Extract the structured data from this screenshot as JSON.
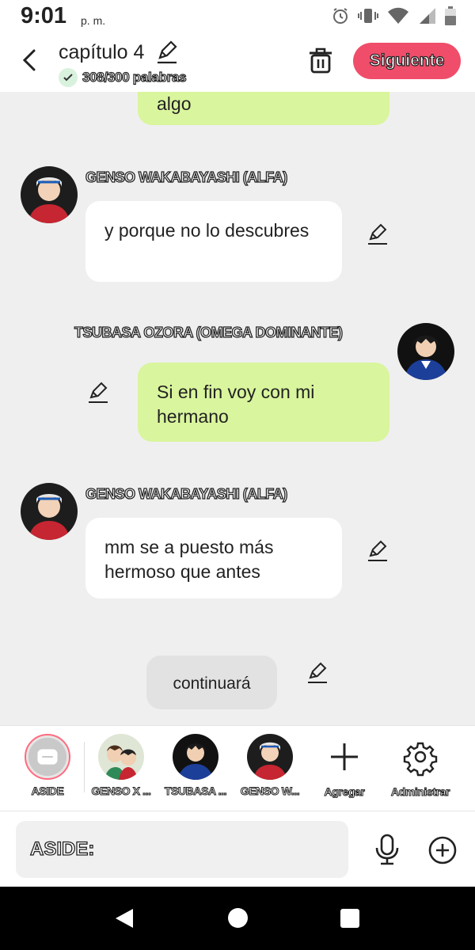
{
  "status_bar": {
    "time": "9:01",
    "ampm": "p. m."
  },
  "header": {
    "title": "capítulo 4",
    "word_count": "308/300 palabras",
    "next_label": "Siguiente"
  },
  "messages": [
    {
      "character": "",
      "side": "right",
      "text": "algo"
    },
    {
      "character": "GENSO WAKABAYASHI (ALFA)",
      "side": "left",
      "text": "y porque no lo descubres"
    },
    {
      "character": "TSUBASA OZORA (OMEGA DOMINANTE)",
      "side": "right",
      "text": "Si en fin voy con mi hermano"
    },
    {
      "character": "GENSO WAKABAYASHI (ALFA)",
      "side": "left",
      "text": "mm se a puesto más hermoso que antes"
    },
    {
      "character": "",
      "side": "center",
      "text": "continuará"
    }
  ],
  "tray": {
    "items": [
      {
        "label": "ASIDE"
      },
      {
        "label": "GENSO X ..."
      },
      {
        "label": "TSUBASA ..."
      },
      {
        "label": "GENSO W..."
      },
      {
        "label": "Agregar"
      },
      {
        "label": "Administrar"
      }
    ]
  },
  "composer": {
    "prefix": "ASIDE:"
  },
  "colors": {
    "accent": "#f04d6a",
    "bubble_green": "#d9f59d",
    "bubble_white": "#ffffff"
  }
}
